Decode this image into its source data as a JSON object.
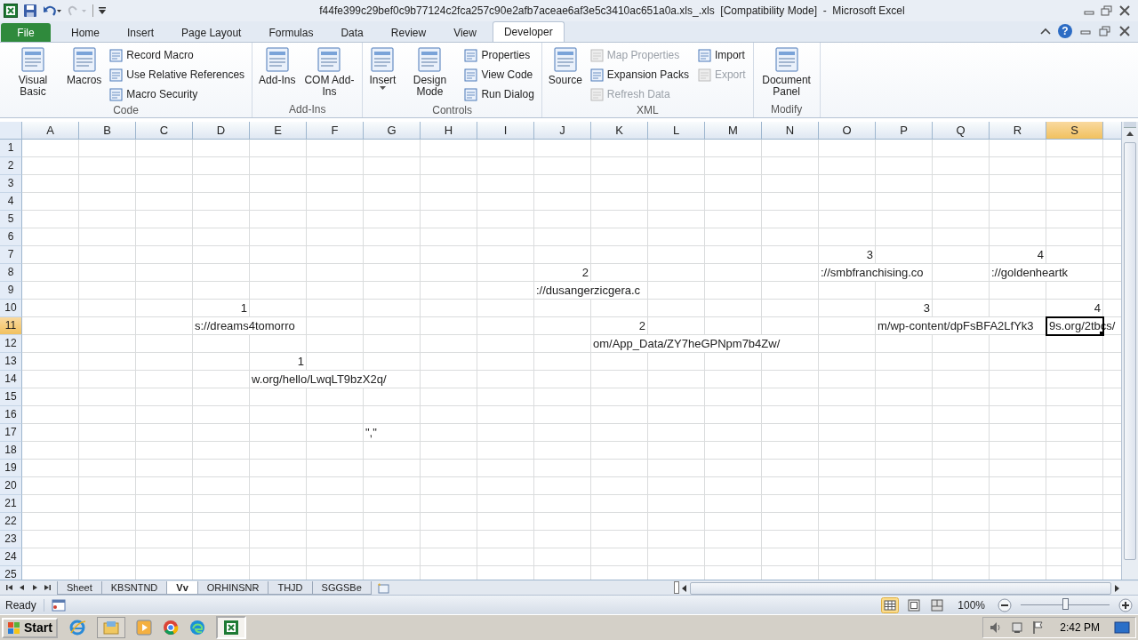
{
  "window": {
    "title": "f44fe399c29bef0c9b77124c2fca257c90e2afb7aceae6af3e5c3410ac651a0a.xls_.xls  [Compatibility Mode]  -  Microsoft Excel",
    "help": "?"
  },
  "tabs": [
    {
      "label": "File",
      "kind": "file",
      "selected": false
    },
    {
      "label": "Home",
      "kind": "tab",
      "selected": false
    },
    {
      "label": "Insert",
      "kind": "tab",
      "selected": false
    },
    {
      "label": "Page Layout",
      "kind": "tab",
      "selected": false
    },
    {
      "label": "Formulas",
      "kind": "tab",
      "selected": false
    },
    {
      "label": "Data",
      "kind": "tab",
      "selected": false
    },
    {
      "label": "Review",
      "kind": "tab",
      "selected": false
    },
    {
      "label": "View",
      "kind": "tab",
      "selected": false
    },
    {
      "label": "Developer",
      "kind": "tab",
      "selected": true
    }
  ],
  "ribbon_groups": [
    {
      "label": "Code",
      "items": [
        {
          "label": "Visual Basic",
          "kind": "large",
          "disabled": false
        },
        {
          "label": "Macros",
          "kind": "large",
          "disabled": false
        },
        {
          "label": "Record Macro",
          "kind": "small",
          "disabled": false
        },
        {
          "label": "Use Relative References",
          "kind": "small",
          "disabled": false
        },
        {
          "label": "Macro Security",
          "kind": "small",
          "disabled": false
        }
      ]
    },
    {
      "label": "Add-Ins",
      "items": [
        {
          "label": "Add-Ins",
          "kind": "large",
          "disabled": false
        },
        {
          "label": "COM Add-Ins",
          "kind": "large",
          "disabled": false
        }
      ]
    },
    {
      "label": "Controls",
      "items": [
        {
          "label": "Insert",
          "kind": "large",
          "dropdown": true,
          "disabled": false
        },
        {
          "label": "Design Mode",
          "kind": "large",
          "disabled": false
        },
        {
          "label": "Properties",
          "kind": "small",
          "disabled": false
        },
        {
          "label": "View Code",
          "kind": "small",
          "disabled": false
        },
        {
          "label": "Run Dialog",
          "kind": "small",
          "disabled": false
        }
      ]
    },
    {
      "label": "XML",
      "items": [
        {
          "label": "Source",
          "kind": "large",
          "disabled": false
        },
        {
          "label": "Map Properties",
          "kind": "small",
          "disabled": true
        },
        {
          "label": "Expansion Packs",
          "kind": "small",
          "disabled": false
        },
        {
          "label": "Refresh Data",
          "kind": "small",
          "disabled": true
        },
        {
          "label": "Import",
          "kind": "small",
          "disabled": false
        },
        {
          "label": "Export",
          "kind": "small",
          "disabled": true
        }
      ]
    },
    {
      "label": "Modify",
      "items": [
        {
          "label": "Document Panel",
          "kind": "large",
          "disabled": false
        }
      ]
    }
  ],
  "sheet": {
    "columns": [
      {
        "label": "A",
        "selected": false
      },
      {
        "label": "B",
        "selected": false
      },
      {
        "label": "C",
        "selected": false
      },
      {
        "label": "D",
        "selected": false
      },
      {
        "label": "E",
        "selected": false
      },
      {
        "label": "F",
        "selected": false
      },
      {
        "label": "G",
        "selected": false
      },
      {
        "label": "H",
        "selected": false
      },
      {
        "label": "I",
        "selected": false
      },
      {
        "label": "J",
        "selected": false
      },
      {
        "label": "K",
        "selected": false
      },
      {
        "label": "L",
        "selected": false
      },
      {
        "label": "M",
        "selected": false
      },
      {
        "label": "N",
        "selected": false
      },
      {
        "label": "O",
        "selected": false
      },
      {
        "label": "P",
        "selected": false
      },
      {
        "label": "Q",
        "selected": false
      },
      {
        "label": "R",
        "selected": false
      },
      {
        "label": "S",
        "selected": true
      }
    ],
    "rows": [
      {
        "label": "1",
        "selected": false
      },
      {
        "label": "2",
        "selected": false
      },
      {
        "label": "3",
        "selected": false
      },
      {
        "label": "4",
        "selected": false
      },
      {
        "label": "5",
        "selected": false
      },
      {
        "label": "6",
        "selected": false
      },
      {
        "label": "7",
        "selected": false,
        "cells": [
          null,
          null,
          null,
          null,
          null,
          null,
          null,
          null,
          null,
          null,
          null,
          null,
          null,
          null,
          {
            "text": "3",
            "kind": "number",
            "selected": false
          },
          null,
          null,
          {
            "text": "4",
            "kind": "number",
            "selected": false
          }
        ]
      },
      {
        "label": "8",
        "selected": false,
        "cells": [
          null,
          null,
          null,
          null,
          null,
          null,
          null,
          null,
          null,
          {
            "text": "2",
            "kind": "number",
            "selected": false
          },
          null,
          null,
          null,
          null,
          {
            "text": "://smbfranchising.co",
            "kind": "text",
            "selected": false
          },
          null,
          null,
          {
            "text": "://goldenheartk",
            "kind": "text",
            "selected": false
          }
        ]
      },
      {
        "label": "9",
        "selected": false,
        "cells": [
          null,
          null,
          null,
          null,
          null,
          null,
          null,
          null,
          null,
          {
            "text": "://dusangerzicgera.c",
            "kind": "text",
            "selected": false
          }
        ]
      },
      {
        "label": "10",
        "selected": false,
        "cells": [
          null,
          null,
          null,
          {
            "text": "1",
            "kind": "number",
            "selected": false
          },
          null,
          null,
          null,
          null,
          null,
          null,
          null,
          null,
          null,
          null,
          null,
          {
            "text": "3",
            "kind": "number",
            "selected": false
          },
          null,
          null,
          {
            "text": "4",
            "kind": "number",
            "selected": false
          }
        ]
      },
      {
        "label": "11",
        "selected": true,
        "cells": [
          null,
          null,
          null,
          {
            "text": "s://dreams4tomorro",
            "kind": "text",
            "selected": false
          },
          null,
          null,
          null,
          null,
          null,
          null,
          {
            "text": "2",
            "kind": "number",
            "selected": false
          },
          null,
          null,
          null,
          null,
          {
            "text": "m/wp-content/dpFsBFA2LfYk3",
            "kind": "text",
            "selected": false
          },
          null,
          null,
          {
            "text": "9s.org/2tbcs/",
            "kind": "text",
            "selected": true
          }
        ]
      },
      {
        "label": "12",
        "selected": false,
        "cells": [
          null,
          null,
          null,
          null,
          null,
          null,
          null,
          null,
          null,
          null,
          {
            "text": "om/App_Data/ZY7heGPNpm7b4Zw/",
            "kind": "text",
            "selected": false
          }
        ]
      },
      {
        "label": "13",
        "selected": false,
        "cells": [
          null,
          null,
          null,
          null,
          {
            "text": "1",
            "kind": "number",
            "selected": false
          }
        ]
      },
      {
        "label": "14",
        "selected": false,
        "cells": [
          null,
          null,
          null,
          null,
          {
            "text": "w.org/hello/LwqLT9bzX2q/",
            "kind": "text",
            "selected": false
          }
        ]
      },
      {
        "label": "15",
        "selected": false
      },
      {
        "label": "16",
        "selected": false
      },
      {
        "label": "17",
        "selected": false,
        "cells": [
          null,
          null,
          null,
          null,
          null,
          null,
          {
            "text": "\",\"",
            "kind": "text",
            "selected": false
          }
        ]
      },
      {
        "label": "18",
        "selected": false
      },
      {
        "label": "19",
        "selected": false
      },
      {
        "label": "20",
        "selected": false
      },
      {
        "label": "21",
        "selected": false
      },
      {
        "label": "22",
        "selected": false
      },
      {
        "label": "23",
        "selected": false
      },
      {
        "label": "24",
        "selected": false
      },
      {
        "label": "25",
        "selected": false
      }
    ]
  },
  "sheet_tabs": [
    {
      "label": "Sheet",
      "selected": false
    },
    {
      "label": "KBSNTND",
      "selected": false
    },
    {
      "label": "Vv",
      "selected": true
    },
    {
      "label": "ORHINSNR",
      "selected": false
    },
    {
      "label": "THJD",
      "selected": false
    },
    {
      "label": "SGGSBe",
      "selected": false
    }
  ],
  "status_bar": {
    "status": "Ready",
    "zoom": "100%",
    "zoom_slider": {
      "level": 0.5
    }
  },
  "taskbar": {
    "start": "Start",
    "clock": "2:42 PM"
  }
}
